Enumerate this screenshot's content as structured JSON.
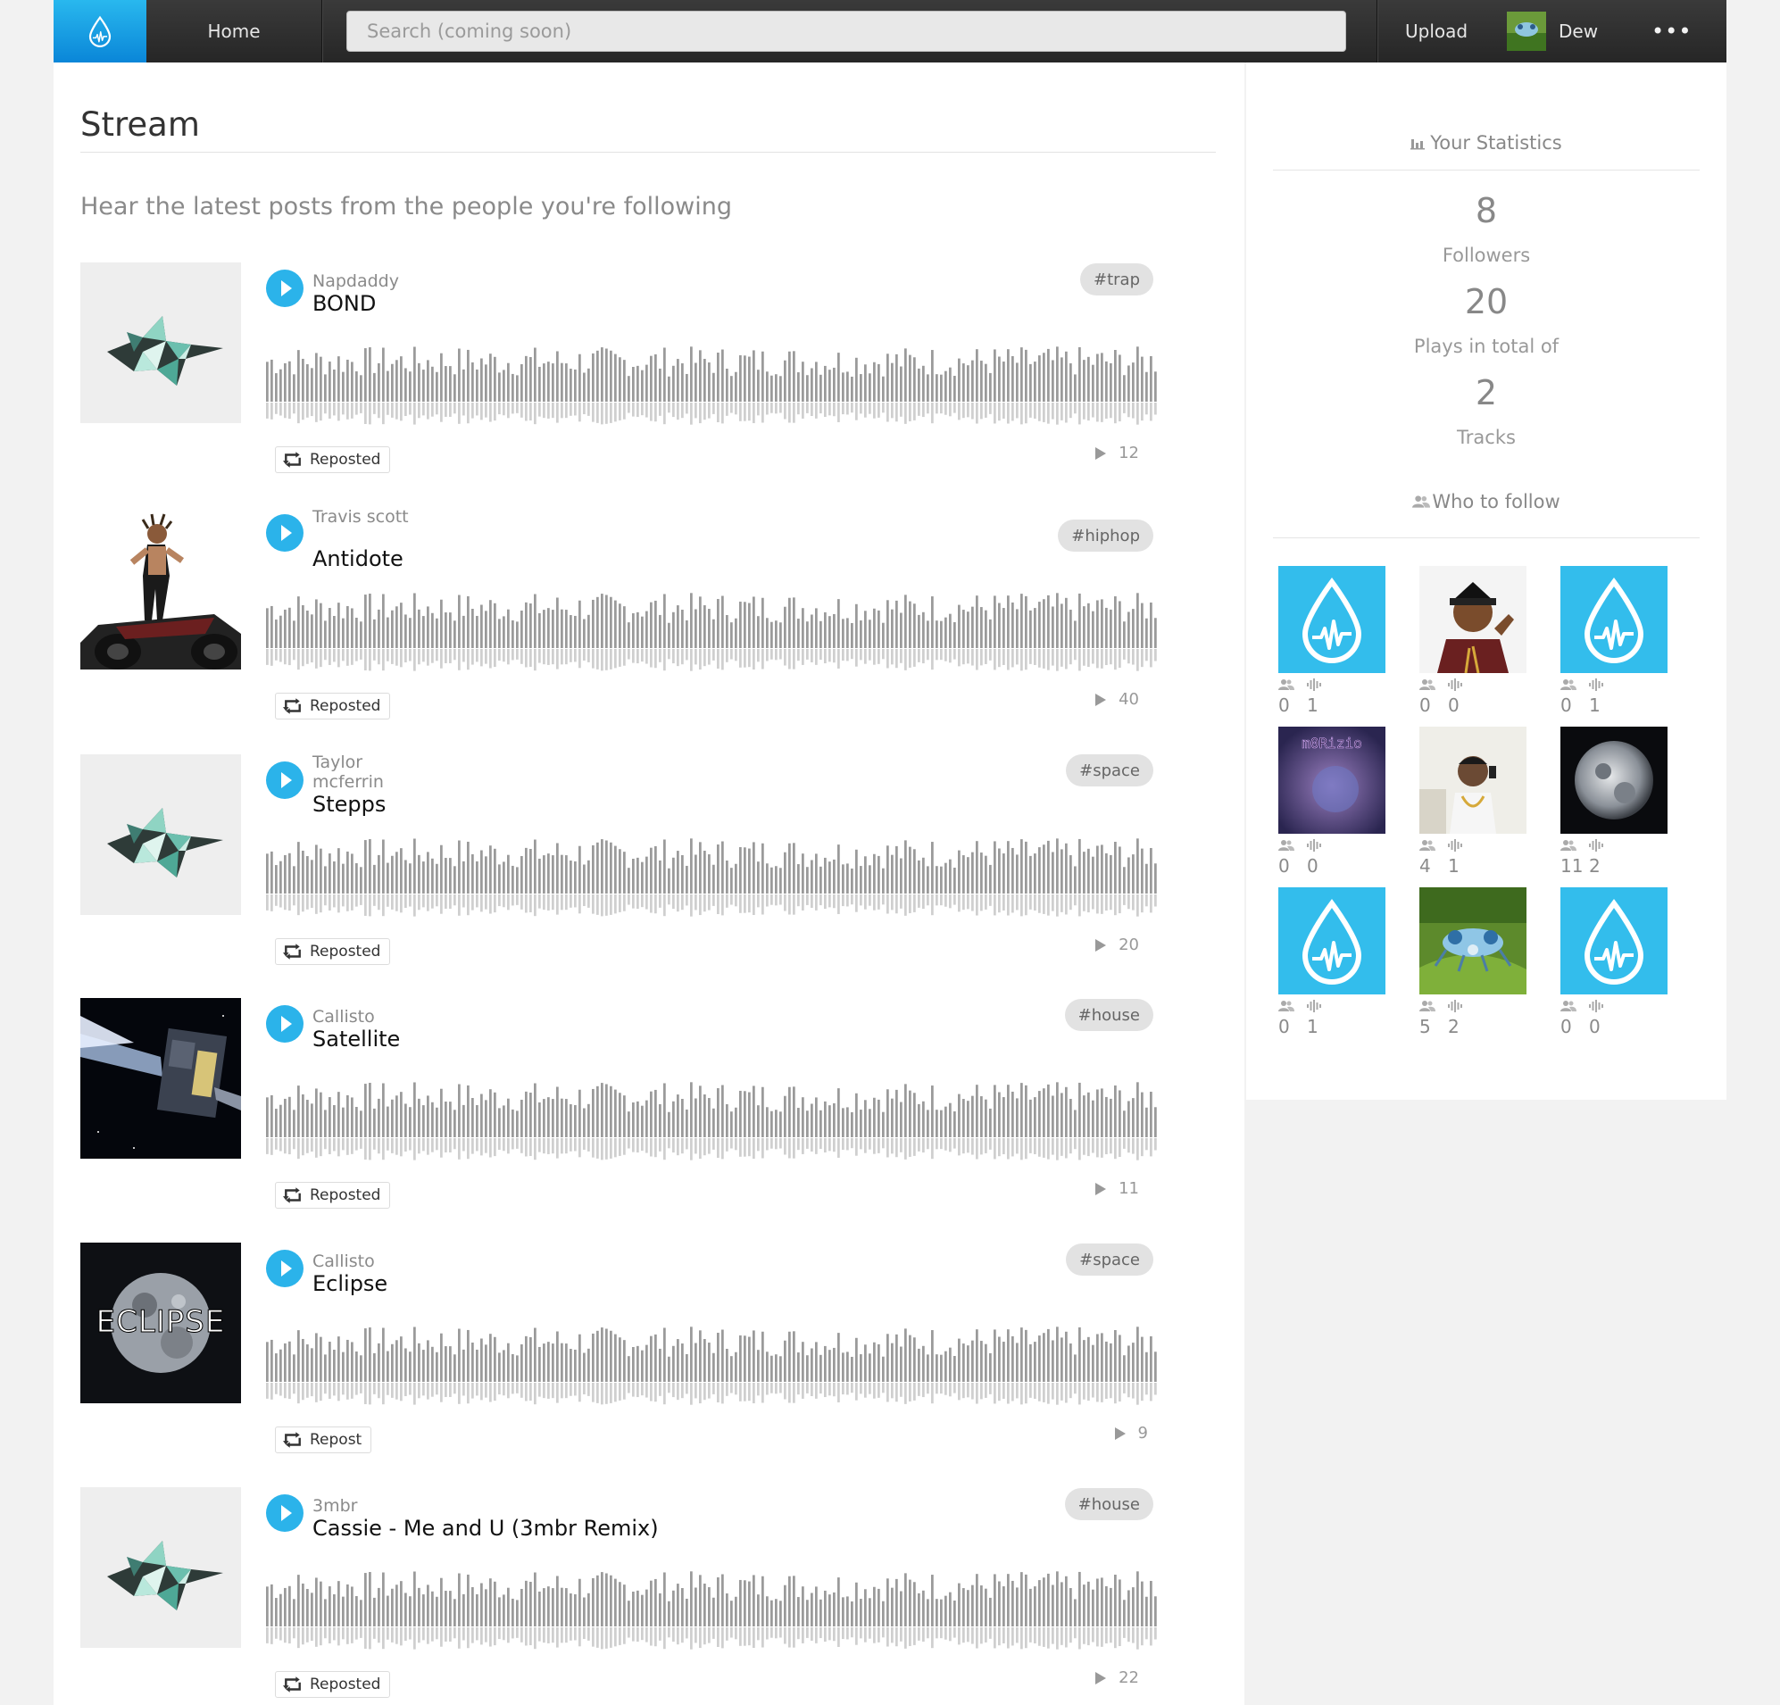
{
  "header": {
    "home_label": "Home",
    "search_placeholder": "Search (coming soon)",
    "upload_label": "Upload",
    "user_name": "Dew",
    "more_label": "•••"
  },
  "stream": {
    "title": "Stream",
    "subtitle": "Hear the latest posts from the people you're following",
    "tracks": [
      {
        "artist": "Napdaddy",
        "title": "BOND",
        "tag": "#trap",
        "repost_label": "Reposted",
        "plays": "12",
        "art_icon": "crystal-art"
      },
      {
        "artist": "Travis scott",
        "title": "Antidote",
        "tag": "#hiphop",
        "repost_label": "Reposted",
        "plays": "40",
        "art_icon": "travis-cover-art"
      },
      {
        "artist": "Taylor mcferrin",
        "title": "Stepps",
        "tag": "#space",
        "repost_label": "Reposted",
        "plays": "20",
        "art_icon": "crystal-art"
      },
      {
        "artist": "Callisto",
        "title": "Satellite",
        "tag": "#house",
        "repost_label": "Reposted",
        "plays": "11",
        "art_icon": "satellite-art"
      },
      {
        "artist": "Callisto",
        "title": "Eclipse",
        "tag": "#space",
        "repost_label": "Repost",
        "plays": "9",
        "art_icon": "eclipse-art"
      },
      {
        "artist": "3mbr",
        "title": "Cassie - Me and U (3mbr Remix)",
        "tag": "#house",
        "repost_label": "Reposted",
        "plays": "22",
        "art_icon": "crystal-art"
      }
    ]
  },
  "sidebar": {
    "stats_heading": "Your Statistics",
    "followers_count": "8",
    "followers_label": "Followers",
    "plays_count": "20",
    "plays_label": "Plays in total of",
    "tracks_count": "2",
    "tracks_label": "Tracks",
    "follow_heading": "Who to follow",
    "who_to_follow": [
      {
        "avatar": "default-drop-avatar",
        "followers": "0",
        "tracks": "1"
      },
      {
        "avatar": "person-photo-avatar",
        "followers": "0",
        "tracks": "0"
      },
      {
        "avatar": "default-drop-avatar",
        "followers": "0",
        "tracks": "1"
      },
      {
        "avatar": "m0rizio-avatar",
        "followers": "0",
        "tracks": "0"
      },
      {
        "avatar": "selfie-photo-avatar",
        "followers": "4",
        "tracks": "1"
      },
      {
        "avatar": "moon-avatar",
        "followers": "11",
        "tracks": "2"
      },
      {
        "avatar": "default-drop-avatar",
        "followers": "0",
        "tracks": "1"
      },
      {
        "avatar": "insect-photo-avatar",
        "followers": "5",
        "tracks": "2"
      },
      {
        "avatar": "default-drop-avatar",
        "followers": "0",
        "tracks": "0"
      }
    ],
    "avatar_texts": {
      "m0rizio": "m0Rizio"
    }
  },
  "eclipse_art_text": "ECLIPSE",
  "colors": {
    "accent": "#2bb3ea",
    "topbar": "#2b2b2b",
    "wave": "#9a9a9a"
  }
}
